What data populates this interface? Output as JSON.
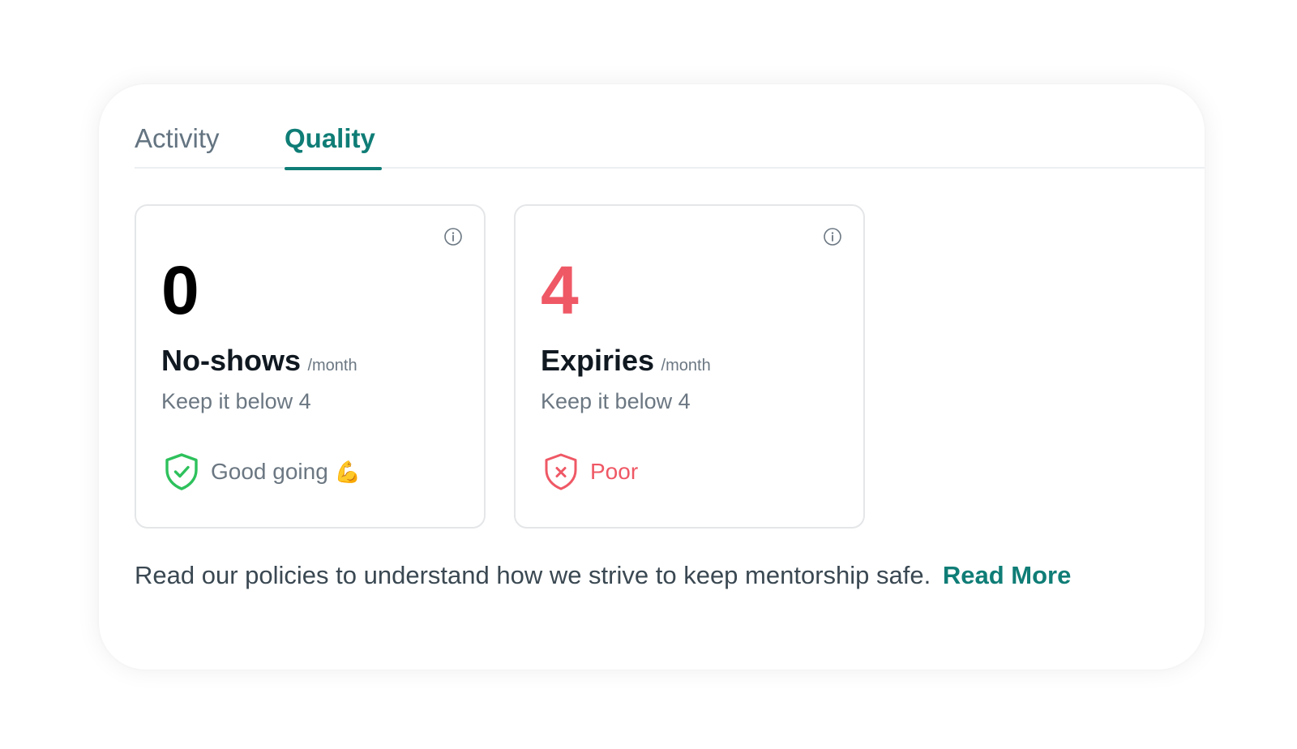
{
  "tabs": [
    {
      "label": "Activity",
      "active": false
    },
    {
      "label": "Quality",
      "active": true
    }
  ],
  "cards": [
    {
      "value": "0",
      "title": "No-shows",
      "period": "/month",
      "hint": "Keep it below 4",
      "status_text": "Good going",
      "status_emoji": "💪",
      "status_icon": "shield-check-icon",
      "status_color": "#2ec15c"
    },
    {
      "value": "4",
      "title": "Expiries",
      "period": "/month",
      "hint": "Keep it below 4",
      "status_text": "Poor",
      "status_icon": "shield-x-icon",
      "status_color": "#ef5865"
    }
  ],
  "footer": {
    "text": "Read our policies to understand how we strive to keep mentorship safe.",
    "link": "Read More"
  },
  "colors": {
    "accent": "#0f7d76",
    "bad": "#ef5865",
    "good": "#2ec15c"
  }
}
